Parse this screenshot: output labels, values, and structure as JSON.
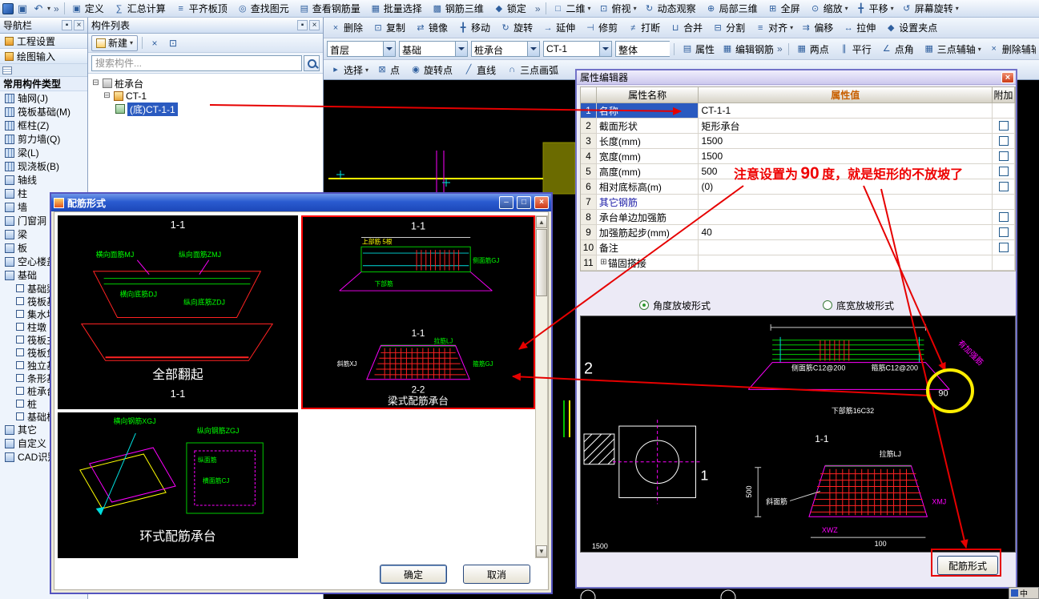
{
  "icons": {
    "save": "▣",
    "undo": "↶",
    "dropdown": "▾",
    "chevron": "»",
    "pin": "▪",
    "close": "×",
    "min": "–",
    "max": "□",
    "collapse": "⊟",
    "expand": "⊞",
    "copy": "⊡",
    "scroll_up": "▲",
    "scroll_down": "▼"
  },
  "main_toolbar": {
    "items": [
      {
        "icon": "▣",
        "label": "定义"
      },
      {
        "icon": "∑",
        "label": "汇总计算"
      },
      {
        "icon": "≡",
        "label": "平齐板顶"
      },
      {
        "icon": "◎",
        "label": "查找图元"
      },
      {
        "icon": "▤",
        "label": "查看钢筋量"
      },
      {
        "icon": "▦",
        "label": "批量选择"
      },
      {
        "icon": "▩",
        "label": "钢筋三维"
      },
      {
        "icon": "◆",
        "label": "锁定"
      }
    ],
    "view_items": [
      {
        "icon": "□",
        "label": "二维",
        "arrow": "▾"
      },
      {
        "icon": "⊡",
        "label": "俯视",
        "arrow": "▾"
      },
      {
        "icon": "↻",
        "label": "动态观察"
      },
      {
        "icon": "⊕",
        "label": "局部三维"
      },
      {
        "icon": "⊞",
        "label": "全屏"
      },
      {
        "icon": "⊙",
        "label": "缩放",
        "arrow": "▾"
      },
      {
        "icon": "╋",
        "label": "平移",
        "arrow": "▾"
      },
      {
        "icon": "↺",
        "label": "屏幕旋转",
        "arrow": "▾"
      }
    ]
  },
  "edit_toolbar": {
    "items": [
      {
        "icon": "×",
        "label": "删除"
      },
      {
        "icon": "⊡",
        "label": "复制"
      },
      {
        "icon": "⇄",
        "label": "镜像"
      },
      {
        "icon": "╋",
        "label": "移动"
      },
      {
        "icon": "↻",
        "label": "旋转"
      },
      {
        "icon": "→",
        "label": "延伸"
      },
      {
        "icon": "⊣",
        "label": "修剪"
      },
      {
        "icon": "≠",
        "label": "打断"
      },
      {
        "icon": "⊔",
        "label": "合并"
      },
      {
        "icon": "⊟",
        "label": "分割"
      },
      {
        "icon": "≡",
        "label": "对齐",
        "arrow": "▾"
      },
      {
        "icon": "⇉",
        "label": "偏移"
      },
      {
        "icon": "↔",
        "label": "拉伸"
      },
      {
        "icon": "◆",
        "label": "设置夹点"
      }
    ]
  },
  "context_toolbar": {
    "combos": [
      {
        "value": "首层"
      },
      {
        "value": "基础"
      },
      {
        "value": "桩承台"
      },
      {
        "value": "CT-1"
      },
      {
        "value": "整体"
      }
    ],
    "buttons": [
      {
        "icon": "▤",
        "label": "属性"
      },
      {
        "icon": "▦",
        "label": "编辑钢筋"
      }
    ],
    "axis_tools": [
      {
        "icon": "▦",
        "label": "两点"
      },
      {
        "icon": "∥",
        "label": "平行"
      },
      {
        "icon": "∠",
        "label": "点角"
      },
      {
        "icon": "▦",
        "label": "三点辅轴",
        "arrow": "▾"
      },
      {
        "icon": "×",
        "label": "删除辅轴"
      }
    ]
  },
  "draw_toolbar": {
    "items": [
      {
        "icon": "▸",
        "label": "选择",
        "arrow": "▾"
      },
      {
        "icon": "⊠",
        "label": "点"
      },
      {
        "icon": "◉",
        "label": "旋转点"
      },
      {
        "icon": "╱",
        "label": "直线"
      },
      {
        "icon": "∩",
        "label": "三点画弧"
      }
    ]
  },
  "navigator": {
    "title": "导航栏",
    "mode_buttons": [
      "工程设置",
      "绘图输入"
    ],
    "section_title": "常用构件类型",
    "common_items": [
      "轴网(J)",
      "筏板基础(M)",
      "框柱(Z)",
      "剪力墙(Q)",
      "梁(L)",
      "现浇板(B)"
    ],
    "groups": [
      "轴线",
      "柱",
      "墙",
      "门窗洞",
      "梁",
      "板",
      "空心楼盖",
      "基础"
    ],
    "foundation_items": [
      "基础梁",
      "筏板基础",
      "集水坑",
      "柱墩",
      "筏板主筋",
      "筏板负筋",
      "独立基础",
      "条形基础",
      "桩承台",
      "桩",
      "基础板带"
    ],
    "bottom_groups": [
      "其它",
      "自定义",
      "CAD识别"
    ]
  },
  "component_list": {
    "title": "构件列表",
    "new_label": "新建",
    "search_placeholder": "搜索构件...",
    "tree": {
      "root": "桩承台",
      "group": "CT-1",
      "leaf": "(底)CT-1-1"
    }
  },
  "property_editor": {
    "title": "属性编辑器",
    "columns": {
      "name": "属性名称",
      "value": "属性值",
      "attach": "附加"
    },
    "rows": [
      {
        "num": "1",
        "name": "名称",
        "value": "CT-1-1"
      },
      {
        "num": "2",
        "name": "截面形状",
        "value": "矩形承台"
      },
      {
        "num": "3",
        "name": "长度(mm)",
        "value": "1500"
      },
      {
        "num": "4",
        "name": "宽度(mm)",
        "value": "1500"
      },
      {
        "num": "5",
        "name": "高度(mm)",
        "value": "500"
      },
      {
        "num": "6",
        "name": "相对底标高(m)",
        "value": "(0)"
      },
      {
        "num": "7",
        "name": "其它钢筋",
        "value": ""
      },
      {
        "num": "8",
        "name": "承台单边加强筋",
        "value": ""
      },
      {
        "num": "9",
        "name": "加强筋起步(mm)",
        "value": "40"
      },
      {
        "num": "10",
        "name": "备注",
        "value": ""
      },
      {
        "num": "11",
        "name": "锚固搭接",
        "value": ""
      }
    ],
    "slope_angle_label": "角度放坡形式",
    "slope_width_label": "底宽放坡形式",
    "preview": {
      "axis_2": "2",
      "axis_1": "1",
      "side_bar": "侧面筋C12@200",
      "stirrup": "箍筋C12@200",
      "bottom_bar": "下部筋16C32",
      "strengthen": "有加强筋",
      "angle": "90",
      "section": "1-1",
      "tie": "拉筋LJ",
      "slant": "斜面筋",
      "xmj": "XMJ",
      "xwz": "XWZ",
      "dim_500": "500",
      "dim_100": "100",
      "dim_1500": "1500"
    },
    "rebar_form_button": "配筋形式"
  },
  "rebar_dialog": {
    "title": "配筋形式",
    "panel1": {
      "header": "1-1",
      "lbl_mj": "横向面筋MJ",
      "lbl_zmj": "纵向面筋ZMJ",
      "lbl_dj": "横向底筋DJ",
      "lbl_zdj": "纵向底筋ZDJ",
      "caption": "全部翻起",
      "sub": "1-1"
    },
    "panel2": {
      "header": "1-1",
      "lbl_top": "上部筋 5根",
      "lbl_side": "侧面筋GJ",
      "lbl_bottom": "下部筋",
      "mid": "1-1",
      "lbl_tie": "拉筋LJ",
      "lbl_xj": "斜筋XJ",
      "lbl_gj": "箍筋GJ",
      "caption_num": "2-2",
      "caption": "梁式配筋承台"
    },
    "panel3": {
      "lbl_xgj": "横向钢筋XGJ",
      "lbl_zgj": "纵向钢筋ZGJ",
      "lbl_zm": "纵面筋",
      "lbl_cj": "横面筋CJ",
      "caption": "环式配筋承台"
    },
    "ok": "确定",
    "cancel": "取消"
  },
  "annotation": {
    "before": "注意设置为",
    "ninety": "90",
    "after": "度，就是矩形的不放坡了"
  },
  "misc": {
    "lang": "中"
  }
}
